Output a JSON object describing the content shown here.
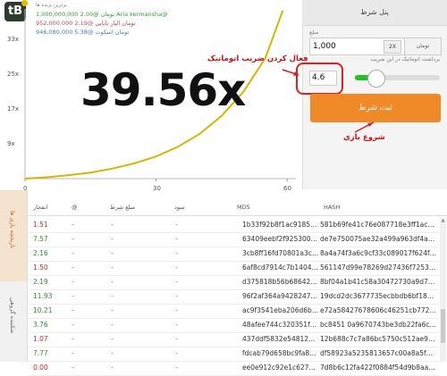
{
  "app": {
    "logo_text": "tB"
  },
  "chart": {
    "multiplier": "39.56x",
    "y_ticks": [
      "33x",
      "25x",
      "17x",
      "9x"
    ],
    "x_ticks": [
      "0",
      "30",
      "60"
    ],
    "leaders_title": "برترین برنده ها",
    "leaders": [
      {
        "text": "1,000,000,000 2.00@ تومان Aria kermansha@",
        "color": "#3a9a3a"
      },
      {
        "text": "952,000,000 2.19@ تومان الیار بابایی",
        "color": "#c05050"
      },
      {
        "text": "946,080,000 5.38@ تومان اسکوت",
        "color": "#4a7ab0"
      }
    ],
    "curve_color": "#d4b800"
  },
  "chart_data": {
    "type": "line",
    "title": "",
    "xlabel": "",
    "ylabel": "",
    "x_ticks": [
      0,
      30,
      60
    ],
    "y_ticks": [
      "9x",
      "17x",
      "25x",
      "33x"
    ],
    "xlim": [
      0,
      62
    ],
    "ylim": [
      1,
      40
    ],
    "series": [
      {
        "values": [
          [
            0,
            1.0
          ],
          [
            5,
            1.3
          ],
          [
            10,
            1.8
          ],
          [
            15,
            2.4
          ],
          [
            20,
            3.3
          ],
          [
            25,
            4.5
          ],
          [
            30,
            6.1
          ],
          [
            35,
            8.3
          ],
          [
            40,
            11.3
          ],
          [
            45,
            15.4
          ],
          [
            50,
            21.0
          ],
          [
            55,
            28.7
          ],
          [
            59,
            39.6
          ]
        ]
      }
    ],
    "current_multiplier": 39.56
  },
  "panel": {
    "title": "پنل شرط",
    "amount_label": "مبلغ",
    "amount_value": "1,000",
    "double_label": "2X",
    "currency": "تومان",
    "auto_label": "برداشت اتوماتیک در این ضریب",
    "auto_value": "4.6",
    "auto_slider_fraction": 0.2,
    "bet_button": "ثبت شرط"
  },
  "annotations": {
    "auto": "فعال کردن ضریب اتوماتیک",
    "start": "شروع بازی"
  },
  "sidebar": {
    "tab_history": "تاریخچه بازی ها",
    "tab_public": "شکننده گروهی"
  },
  "table": {
    "headers": {
      "crash": "انفجار",
      "at": "@",
      "amount": "مبلغ شرط",
      "profit": "سود",
      "md5": "MD5",
      "hash": "HASH"
    },
    "rows": [
      {
        "crash": "1.51",
        "at": "-",
        "amount": "-",
        "profit": "-",
        "md5": "1b33f92b8f1ac9185…",
        "hash": "581b69fe41c76e087718e3ff1ac…"
      },
      {
        "crash": "7.57",
        "at": "-",
        "amount": "-",
        "profit": "-",
        "md5": "63409eebf2f925300…",
        "hash": "de7e750075ae32a499a963df4a…"
      },
      {
        "crash": "2.16",
        "at": "-",
        "amount": "-",
        "profit": "-",
        "md5": "3cb8ff16fd70801a3c…",
        "hash": "8a4a74f3a6c9cf33c089017f624f…"
      },
      {
        "crash": "1.50",
        "at": "-",
        "amount": "-",
        "profit": "-",
        "md5": "6af8cd7914c7b1404…",
        "hash": "561147d99e78269d27436f7253…"
      },
      {
        "crash": "2.19",
        "at": "-",
        "amount": "-",
        "profit": "-",
        "md5": "d375818b56b68642…",
        "hash": "8bf04a1b41c58a30472730a9d7…"
      },
      {
        "crash": "11.93",
        "at": "-",
        "amount": "-",
        "profit": "-",
        "md5": "96f2af364a9428247…",
        "hash": "19dcd2dc3677735ecbbdb6bf18…"
      },
      {
        "crash": "10.21",
        "at": "-",
        "amount": "-",
        "profit": "-",
        "md5": "ac9f3541eba206d6b…",
        "hash": "e72a58427678606c46251cb772…"
      },
      {
        "crash": "3.76",
        "at": "-",
        "amount": "-",
        "profit": "-",
        "md5": "48afee744c320351f…",
        "hash": "bc8451 0a9670743be3db22fa6c…"
      },
      {
        "crash": "1.07",
        "at": "-",
        "amount": "-",
        "profit": "-",
        "md5": "437ddf5832e54812…",
        "hash": "12b688c7c7a86bc5750c512ae9…"
      },
      {
        "crash": "7.77",
        "at": "-",
        "amount": "-",
        "profit": "-",
        "md5": "fdcab79d658bc9fa8…",
        "hash": "df58923a5235813657c00a8a5f…"
      },
      {
        "crash": "0.00",
        "at": "-",
        "amount": "-",
        "profit": "-",
        "md5": "ee0e912c92e1c627…",
        "hash": "7d8b6c12fa422f0884f54d9b8aa…"
      }
    ],
    "crash_color": "#3a8a3a",
    "crash_low_color": "#c03030"
  }
}
